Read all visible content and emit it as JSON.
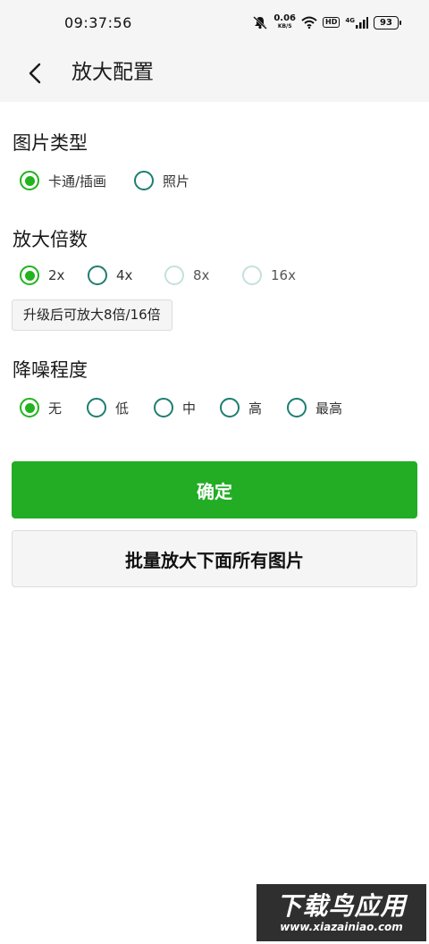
{
  "status_bar": {
    "time": "09:37:56",
    "net_speed_value": "0.06",
    "net_speed_unit": "KB/S",
    "hd_label": "HD",
    "signal_label": "4G",
    "battery_level": "93"
  },
  "app_bar": {
    "title": "放大配置"
  },
  "image_type": {
    "title": "图片类型",
    "options": [
      {
        "label": "卡通/插画",
        "checked": true
      },
      {
        "label": "照片",
        "checked": false
      }
    ]
  },
  "scale": {
    "title": "放大倍数",
    "options": [
      {
        "label": "2x",
        "checked": true
      },
      {
        "label": "4x",
        "checked": false
      },
      {
        "label": "8x",
        "checked": false,
        "disabled": true
      },
      {
        "label": "16x",
        "checked": false,
        "disabled": true
      }
    ],
    "upgrade_tip": "升级后可放大8倍/16倍"
  },
  "denoise": {
    "title": "降噪程度",
    "options": [
      {
        "label": "无",
        "checked": true
      },
      {
        "label": "低",
        "checked": false
      },
      {
        "label": "中",
        "checked": false
      },
      {
        "label": "高",
        "checked": false
      },
      {
        "label": "最高",
        "checked": false
      }
    ]
  },
  "actions": {
    "confirm_label": "确定",
    "batch_label": "批量放大下面所有图片"
  },
  "watermark": {
    "main": "下载鸟应用",
    "sub": "www.xiazainiao.com"
  },
  "colors": {
    "accent": "#22ad25",
    "radio_unchecked": "#1e7d6f",
    "radio_disabled": "#c4e1dc"
  }
}
